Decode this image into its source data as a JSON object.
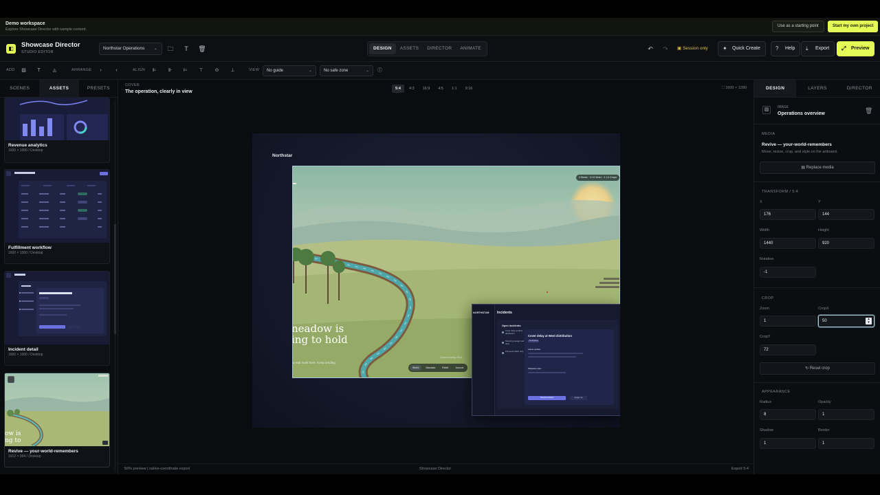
{
  "banner": {
    "title": "Demo workspace",
    "subtitle": "Explore Showcase Director with sample content.",
    "start_point_label": "Use as a starting point",
    "own_project_label": "Start my own project"
  },
  "topbar": {
    "app_title": "Showcase Director",
    "app_subtitle": "STUDIO EDITOR",
    "project": "Northstar Operations",
    "modes": [
      "DESIGN",
      "ASSETS",
      "DIRECTOR",
      "ANIMATE"
    ],
    "active_mode": "DESIGN",
    "session_label": "Session only",
    "quick_create": "Quick Create",
    "help": "Help",
    "export": "Export",
    "preview": "Preview"
  },
  "toolrow": {
    "add_label": "ADD",
    "arrange_label": "ARRANGE",
    "align_label": "ALIGN",
    "view_label": "VIEW",
    "guide_value": "No guide",
    "safe_zone_value": "No safe zone"
  },
  "left_panel": {
    "tabs": [
      "SCENES",
      "ASSETS",
      "PRESETS"
    ],
    "active_tab": "ASSETS",
    "assets": [
      {
        "name": "Revenue analytics",
        "meta": "1600 × 1000 / Desktop"
      },
      {
        "name": "Fulfillment workflow",
        "meta": "1600 × 1000 / Desktop"
      },
      {
        "name": "Incident detail",
        "meta": "1600 × 1000 / Desktop"
      },
      {
        "name": "Revive — your-world-remembers",
        "meta": "1912 × 994 / Desktop"
      }
    ]
  },
  "canvas": {
    "section": "COVER",
    "title": "The operation, clearly in view",
    "ratios": [
      "5:4",
      "4:3",
      "16:9",
      "4:5",
      "1:1",
      "9:16"
    ],
    "active_ratio": "5:4",
    "dims": "1600 × 1280",
    "artboard": {
      "brand": "Northstar",
      "hero_line1": "neadow is",
      "hero_line2": "ing to hold",
      "hero_sub": "a real mark here. Keep tending.",
      "hero_pill": "4 Music · 4:12 timer · 4 14 Crops",
      "hero_caption": "Quiet morning. Rest.",
      "hero_tabs": [
        "World",
        "Mandala",
        "Relief",
        "Journal"
      ],
      "incidents_brand": "NORTHSTAR",
      "incidents_title": "Incidents",
      "open_label": "Open incidents",
      "items": [
        "Cover delay at West distribution",
        "Scanning outage near dock",
        "Payments batch retry"
      ],
      "detail_title": "Cover delay at West distribution",
      "detail_status": "Investigating",
      "detail_latest": "Latest update",
      "detail_mitigation": "Mitigation plan",
      "resolve_label": "Resolve incident",
      "assign_label": "Assign me"
    },
    "footer_left": "50% preview | native-coordinate export",
    "footer_center": "Showcase Director",
    "footer_right": "Export 5:4"
  },
  "right_panel": {
    "tabs": [
      "DESIGN",
      "LAYERS",
      "DIRECTOR"
    ],
    "active_tab": "DESIGN",
    "type_label": "IMAGE",
    "layer_name": "Operations overview",
    "media_label": "MEDIA",
    "media_name": "Revive — your-world-remembers",
    "media_hint": "Move, resize, crop, and style on the artboard.",
    "replace_label": "Replace media",
    "transform_label": "TRANSFORM / 5:4",
    "x_label": "X",
    "x": "176",
    "y_label": "Y",
    "y": "144",
    "width_label": "Width",
    "width": "1440",
    "height_label": "Height",
    "height": "920",
    "rotation_label": "Rotation",
    "rotation": "-1",
    "crop_label": "CROP",
    "zoom_label": "Zoom",
    "zoom": "1",
    "cropx_label": "CropX",
    "cropx": "50",
    "cropy_label": "CropY",
    "cropy": "72",
    "reset_crop": "Reset crop",
    "appearance_label": "APPEARANCE",
    "radius_label": "Radius",
    "radius": "8",
    "opacity_label": "Opacity",
    "opacity": "1",
    "shadow_label": "Shadow",
    "shadow": "1",
    "border_label": "Border",
    "border": "1"
  }
}
